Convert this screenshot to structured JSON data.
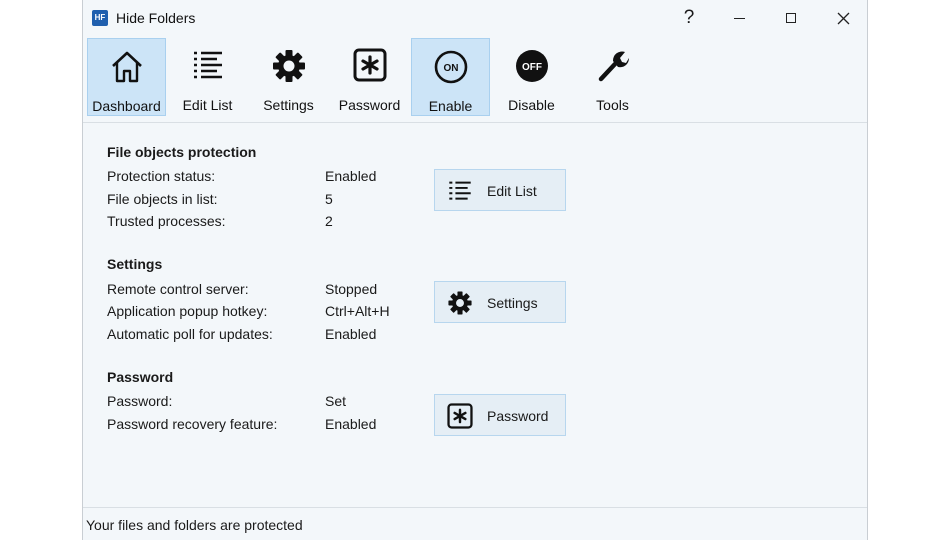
{
  "window": {
    "title": "Hide Folders",
    "app_icon_text": "HF",
    "help_symbol": "?"
  },
  "toolbar": {
    "items": [
      {
        "label": "Dashboard",
        "icon": "home-icon",
        "active": true
      },
      {
        "label": "Edit List",
        "icon": "list-icon",
        "active": false
      },
      {
        "label": "Settings",
        "icon": "gear-icon",
        "active": false
      },
      {
        "label": "Password",
        "icon": "asterisk-box-icon",
        "active": false
      },
      {
        "label": "Enable",
        "icon": "on-icon",
        "active": true
      },
      {
        "label": "Disable",
        "icon": "off-icon",
        "active": false
      },
      {
        "label": "Tools",
        "icon": "wrench-icon",
        "active": false
      }
    ],
    "on_text": "ON",
    "off_text": "OFF"
  },
  "sections": {
    "protection": {
      "title": "File objects protection",
      "rows": [
        {
          "label": "Protection status:",
          "value": "Enabled"
        },
        {
          "label": "File objects in list:",
          "value": "5"
        },
        {
          "label": "Trusted processes:",
          "value": "2"
        }
      ],
      "button": {
        "label": "Edit List",
        "icon": "list-icon"
      }
    },
    "settings": {
      "title": "Settings",
      "rows": [
        {
          "label": "Remote control server:",
          "value": "Stopped"
        },
        {
          "label": "Application popup hotkey:",
          "value": "Ctrl+Alt+H"
        },
        {
          "label": "Automatic poll for updates:",
          "value": "Enabled"
        }
      ],
      "button": {
        "label": "Settings",
        "icon": "gear-icon"
      }
    },
    "password": {
      "title": "Password",
      "rows": [
        {
          "label": "Password:",
          "value": "Set"
        },
        {
          "label": "Password recovery feature:",
          "value": "Enabled"
        }
      ],
      "button": {
        "label": "Password",
        "icon": "asterisk-box-icon"
      }
    }
  },
  "status": {
    "text": "Your files and folders are protected"
  },
  "colors": {
    "accent_bg": "#cce4f7",
    "accent_border": "#a9d0ef",
    "button_bg": "#e5eef5",
    "window_bg": "#f3f7fa"
  }
}
